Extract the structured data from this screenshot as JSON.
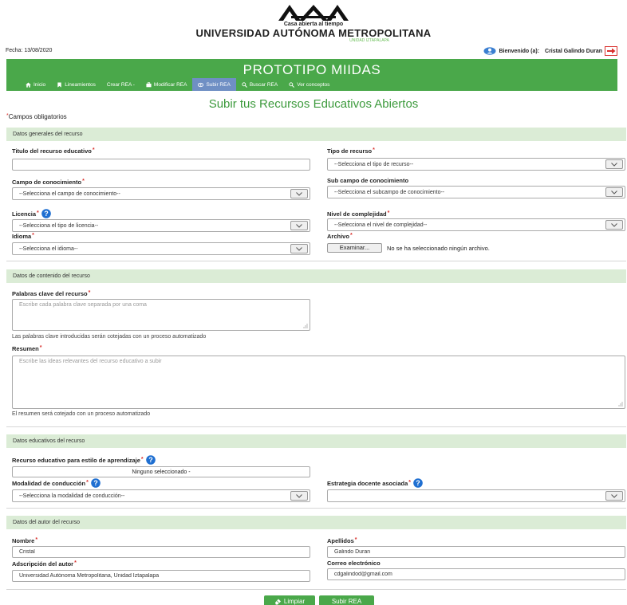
{
  "header": {
    "motto": "Casa abierta al tiempo",
    "university": "UNIVERSIDAD AUTÓNOMA METROPOLITANA",
    "unit": "UNIDAD IZTAPALAPA"
  },
  "topbar": {
    "date": "Fecha: 13/08/2020",
    "welcome_prefix": "Bienvenido (a):",
    "user_name": "Cristal Galindo Duran"
  },
  "banner": {
    "title": "PROTOTIPO MIIDAS"
  },
  "nav": [
    {
      "label": "Inicio",
      "icon": "home-icon"
    },
    {
      "label": "Lineamientos",
      "icon": "bookmark-icon"
    },
    {
      "label": "Crear REA -",
      "icon": ""
    },
    {
      "label": "Modificar REA",
      "icon": "briefcase-icon"
    },
    {
      "label": "Subir REA",
      "icon": "eye-icon"
    },
    {
      "label": "Buscar REA",
      "icon": "search-icon"
    },
    {
      "label": "Ver conceptos",
      "icon": "search-icon"
    }
  ],
  "page": {
    "title": "Subir tus Recursos Educativos Abiertos",
    "required_note": "Campos obligatorios"
  },
  "sections": {
    "general": "Datos generales del recurso",
    "content": "Datos de contenido del recurso",
    "educational": "Datos educativos del recurso",
    "author": "Datos del autor del recurso"
  },
  "general": {
    "title_label": "Titulo del recurso educativo",
    "title_value": "",
    "type_label": "Tipo de recurso",
    "type_value": "--Selecciona el tipo de recurso--",
    "field_label": "Campo de conocimiento",
    "field_value": "--Selecciona el campo de conocimiento--",
    "subfield_label": "Sub campo de conocimiento",
    "subfield_value": "--Selecciona el subcampo de conocimiento--",
    "license_label": "Licencia",
    "license_value": "--Selecciona el tipo de licencia--",
    "complexity_label": "Nivel de complejidad",
    "complexity_value": "--Selecciona el nivel de complejidad--",
    "language_label": "Idioma",
    "language_value": "--Selecciona el idioma--",
    "file_label": "Archivo",
    "file_button": "Examinar...",
    "file_status": "No se ha seleccionado ningún archivo."
  },
  "content": {
    "keywords_label": "Palabras clave del recurso",
    "keywords_placeholder": "Escribe cada palabra clave separada por una coma",
    "keywords_hint": "Las palabras clave introducidas serán cotejadas con un proceso automatizado",
    "summary_label": "Resumen",
    "summary_placeholder": "Escribe las ideas relevantes del recurso educativo a subir",
    "summary_hint": "El resumen será cotejado con un proceso automatizado"
  },
  "educational": {
    "style_label": "Recurso educativo para estilo de aprendizaje",
    "style_value": "Ninguno seleccionado -",
    "modality_label": "Modalidad de conducción",
    "modality_value": "--Selecciona la modalidad de conducción--",
    "strategy_label": "Estrategia docente asociada",
    "strategy_value": ""
  },
  "author": {
    "name_label": "Nombre",
    "name_value": "Cristal",
    "surname_label": "Apellidos",
    "surname_value": "Galindo Duran",
    "affiliation_label": "Adscripción del autor",
    "affiliation_value": "Universidad Autónoma Metropolitana, Unidad Iztapalapa",
    "email_label": "Correo electrónico",
    "email_value": "cdgalindod@gmail.com"
  },
  "actions": {
    "clear": "Limpiar",
    "submit": "Subir REA"
  },
  "colors": {
    "brand_green": "#4aa84a",
    "section_bg": "#dbecd6",
    "nav_active": "#6f8fc4",
    "required": "#d9302c"
  }
}
